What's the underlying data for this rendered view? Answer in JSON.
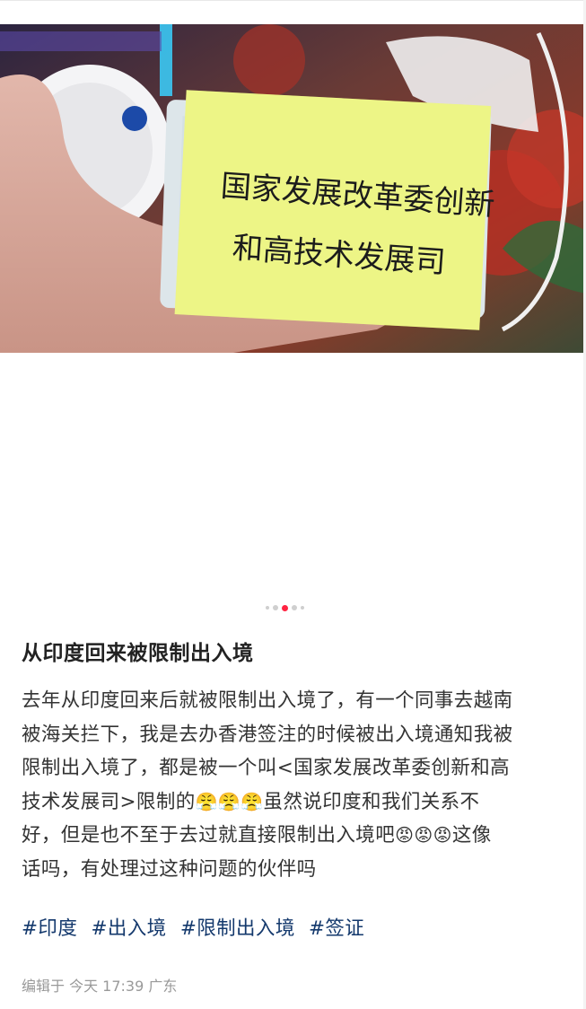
{
  "post": {
    "title": "从印度回来被限制出入境",
    "body_lines": [
      "去年从印度回来后就被限制出入境了，有一个同事去越南",
      "被海关拦下，我是去办香港签注的时候被出入境通知我被",
      "限制出入境了，都是被一个叫<国家发展改革委创新和高",
      "技术发展司>限制的",
      "虽然说印度和我们关系不",
      "好，但是也不至于去过就直接限制出入境吧",
      "这像",
      "话吗，有处理过这种问题的伙伴吗"
    ],
    "emoji_group_1": "😤😤😤",
    "emoji_group_2": "😡😡😡",
    "tags": [
      "#印度",
      "#出入境",
      "#限制出入境",
      "#签证"
    ],
    "meta": "编辑于  今天 17:39 广东"
  },
  "photo": {
    "note_line_1": "国家发展改革委创新",
    "note_line_2": "和高技术发展司"
  },
  "carousel": {
    "total": 5,
    "active_index": 2
  },
  "colors": {
    "accent": "#ff2442",
    "tag": "#13386c",
    "meta": "#999999",
    "note": "#e8f27a"
  }
}
